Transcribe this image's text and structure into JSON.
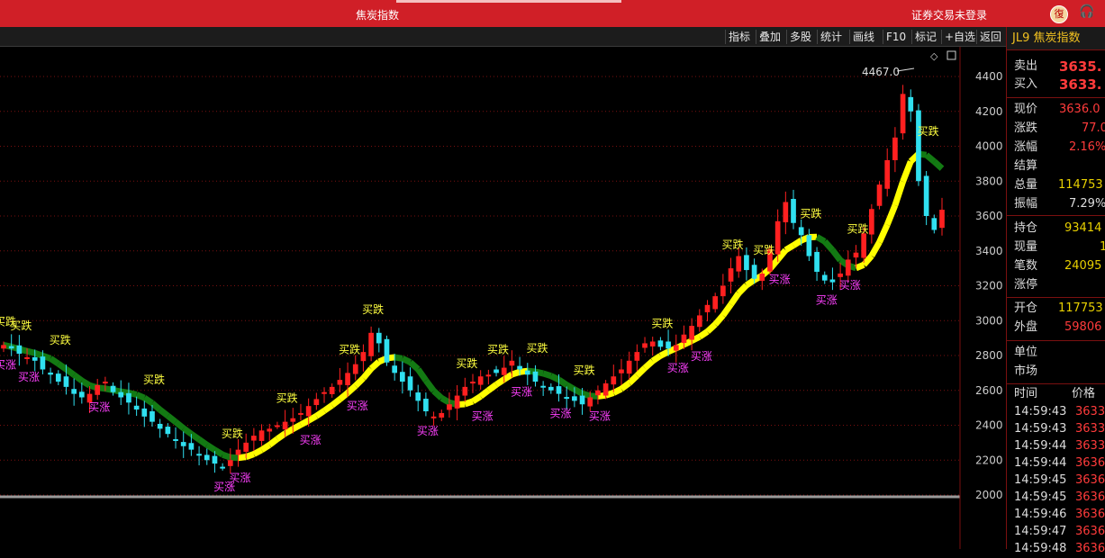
{
  "window": {
    "title": "焦炭指数",
    "login_status": "证券交易未登录",
    "logo_char": "復"
  },
  "toolbar": {
    "items": [
      "指标",
      "叠加",
      "多股",
      "统计",
      "画线",
      "F10",
      "标记",
      "+自选",
      "返回"
    ]
  },
  "instrument": {
    "code_label": "JL9 焦炭指数"
  },
  "quote": {
    "sell_label": "卖出",
    "sell_value": "3635.",
    "buy_label": "买入",
    "buy_value": "3633.",
    "price_label": "现价",
    "price_value": "3636.0",
    "change_label": "涨跌",
    "change_value": "77.0",
    "pct_label": "涨幅",
    "pct_value": "2.16%",
    "settle_label": "结算",
    "settle_value": "",
    "volume_label": "总量",
    "volume_value": "114753",
    "amplitude_label": "振幅",
    "amplitude_value": "7.29%",
    "oi_label": "持仓",
    "oi_value": "93414",
    "curvol_label": "现量",
    "curvol_value": "1",
    "trades_label": "笔数",
    "trades_value": "24095",
    "limit_label": "涨停",
    "limit_value": "",
    "open_oi_label": "开仓",
    "open_oi_value": "117753",
    "outer_label": "外盘",
    "outer_value": "59806",
    "unit_label": "单位",
    "market_label": "市场",
    "ticks_header_time": "时间",
    "ticks_header_price": "价格",
    "ticks": [
      {
        "time": "14:59:43",
        "price": "3633."
      },
      {
        "time": "14:59:43",
        "price": "3633."
      },
      {
        "time": "14:59:44",
        "price": "3633."
      },
      {
        "time": "14:59:44",
        "price": "3636."
      },
      {
        "time": "14:59:45",
        "price": "3636."
      },
      {
        "time": "14:59:45",
        "price": "3636."
      },
      {
        "time": "14:59:46",
        "price": "3636."
      },
      {
        "time": "14:59:47",
        "price": "3636."
      },
      {
        "time": "14:59:48",
        "price": "3636."
      }
    ]
  },
  "colors": {
    "up": "#ff2020",
    "down": "#30e0f0",
    "line_up": "#ffff00",
    "line_down": "#137a13",
    "buy_fall": "#ffff40",
    "buy_rise": "#ff40ff",
    "grid": "#7a1010",
    "axis_text": "#cccccc"
  },
  "chart_data": {
    "type": "candlestick",
    "y_ticks": [
      2000,
      2200,
      2400,
      2600,
      2800,
      3000,
      3200,
      3400,
      3600,
      3800,
      4000,
      4200,
      4400
    ],
    "ylim": [
      1985,
      4545
    ],
    "high_marker": "4467.0",
    "closes": [
      2860,
      2840,
      2810,
      2790,
      2770,
      2720,
      2690,
      2650,
      2620,
      2580,
      2560,
      2580,
      2630,
      2650,
      2590,
      2560,
      2530,
      2490,
      2450,
      2420,
      2380,
      2350,
      2310,
      2280,
      2260,
      2230,
      2200,
      2180,
      2160,
      2200,
      2260,
      2300,
      2340,
      2370,
      2380,
      2400,
      2420,
      2440,
      2470,
      2510,
      2550,
      2590,
      2620,
      2660,
      2700,
      2750,
      2820,
      2930,
      2870,
      2760,
      2700,
      2650,
      2600,
      2540,
      2480,
      2450,
      2470,
      2520,
      2570,
      2620,
      2650,
      2680,
      2690,
      2700,
      2730,
      2770,
      2720,
      2690,
      2650,
      2620,
      2600,
      2580,
      2560,
      2540,
      2520,
      2560,
      2600,
      2640,
      2680,
      2720,
      2770,
      2820,
      2870,
      2880,
      2850,
      2840,
      2860,
      2920,
      2970,
      3030,
      3090,
      3140,
      3200,
      3300,
      3370,
      3290,
      3240,
      3270,
      3410,
      3570,
      3680,
      3560,
      3490,
      3370,
      3280,
      3230,
      3220,
      3270,
      3350,
      3390,
      3500,
      3640,
      3780,
      3920,
      4050,
      4300,
      4200,
      3800,
      3600,
      3520,
      3636
    ],
    "markers": [
      {
        "label": "买跌",
        "i": 0
      },
      {
        "label": "买涨",
        "i": 0
      },
      {
        "label": "买跌",
        "i": 2
      },
      {
        "label": "买涨",
        "i": 3
      },
      {
        "label": "买跌",
        "i": 7
      },
      {
        "label": "买涨",
        "i": 12
      },
      {
        "label": "买跌",
        "i": 19
      },
      {
        "label": "买跌",
        "i": 29
      },
      {
        "label": "买涨",
        "i": 28
      },
      {
        "label": "买涨",
        "i": 30
      },
      {
        "label": "买涨",
        "i": 39
      },
      {
        "label": "买跌",
        "i": 36
      },
      {
        "label": "买跌",
        "i": 47
      },
      {
        "label": "买跌",
        "i": 44
      },
      {
        "label": "买涨",
        "i": 45
      },
      {
        "label": "买涨",
        "i": 54
      },
      {
        "label": "买跌",
        "i": 59
      },
      {
        "label": "买涨",
        "i": 61
      },
      {
        "label": "买跌",
        "i": 63
      },
      {
        "label": "买涨",
        "i": 66
      },
      {
        "label": "买跌",
        "i": 68
      },
      {
        "label": "买涨",
        "i": 71
      },
      {
        "label": "买跌",
        "i": 74
      },
      {
        "label": "买涨",
        "i": 76
      },
      {
        "label": "买跌",
        "i": 84
      },
      {
        "label": "买涨",
        "i": 86
      },
      {
        "label": "买涨",
        "i": 89
      },
      {
        "label": "买跌",
        "i": 93
      },
      {
        "label": "买跌",
        "i": 97
      },
      {
        "label": "买涨",
        "i": 99
      },
      {
        "label": "买跌",
        "i": 103
      },
      {
        "label": "买涨",
        "i": 105
      },
      {
        "label": "买涨",
        "i": 108
      },
      {
        "label": "买跌",
        "i": 109
      },
      {
        "label": "买跌",
        "i": 118
      }
    ]
  }
}
